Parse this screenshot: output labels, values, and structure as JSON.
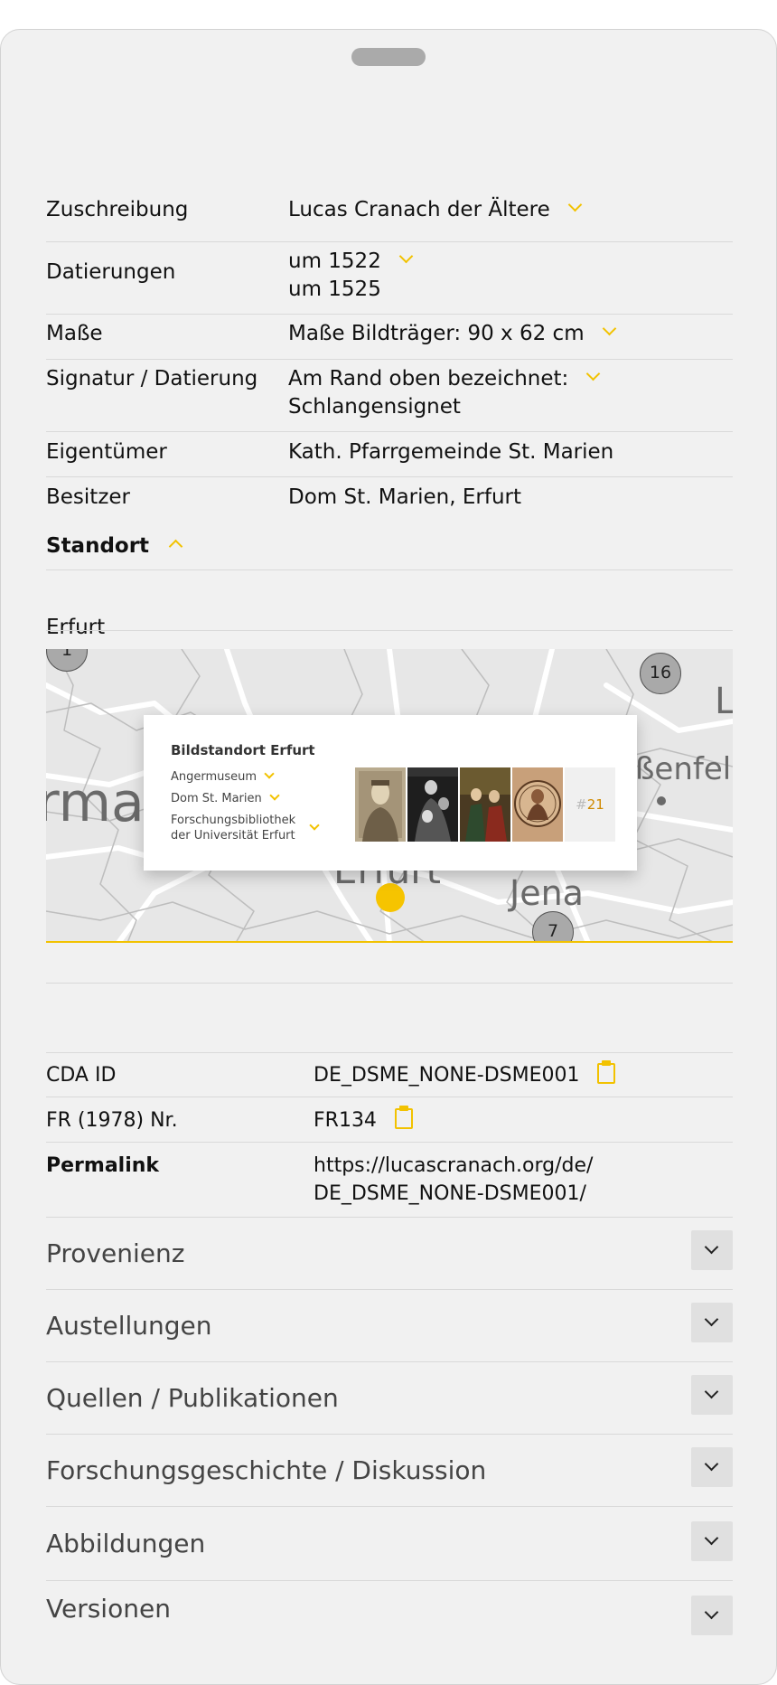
{
  "attributes": [
    {
      "label": "Zuschreibung",
      "value": "Lucas Cranach der Ältere"
    },
    {
      "label": "Datierungen",
      "value": "um 1522",
      "value2": "um 1525"
    },
    {
      "label": "Maße",
      "value": "Maße Bildträger: 90 x 62 cm"
    },
    {
      "label": "Signatur / Datierung",
      "value": "Am Rand oben bezeichnet:",
      "value2": "Schlangensignet"
    },
    {
      "label": "Eigentümer",
      "value": "Kath. Pfarrgemeinde St. Marien"
    },
    {
      "label": "Besitzer",
      "value": "Dom St. Marien, Erfurt"
    }
  ],
  "standort": {
    "title": "Standort",
    "city": "Erfurt"
  },
  "map": {
    "labels": {
      "erfurt": "Erfurt",
      "jena": "Jena",
      "left_fragment": "rma",
      "right_fragment": "ßenfel",
      "top_right_fragment": "L"
    },
    "clusters": {
      "top_left": "1",
      "top_right": "16",
      "bottom": "7"
    },
    "popup": {
      "title": "Bildstandort Erfurt",
      "links": [
        "Angermuseum",
        "Dom St. Marien",
        "Forschungsbibliothek",
        "der Universität Erfurt"
      ],
      "count_hash": "#",
      "count": "21"
    }
  },
  "identifiers": [
    {
      "label": "CDA ID",
      "value": "DE_DSME_NONE-DSME001"
    },
    {
      "label": "FR (1978) Nr.",
      "value": "FR134"
    },
    {
      "label": "Permalink",
      "value": "https://lucascranach.org/de/",
      "value2": "DE_DSME_NONE-DSME001/"
    }
  ],
  "accordion": [
    {
      "title": "Provenienz"
    },
    {
      "title": "Austellungen"
    },
    {
      "title": "Quellen / Publikationen"
    },
    {
      "title": "Forschungsgeschichte / Diskussion"
    },
    {
      "title": "Abbildungen"
    },
    {
      "title": "Versionen"
    }
  ],
  "colors": {
    "accent": "#f2c200",
    "background": "#f1f1f1",
    "count": "#d08a00"
  }
}
